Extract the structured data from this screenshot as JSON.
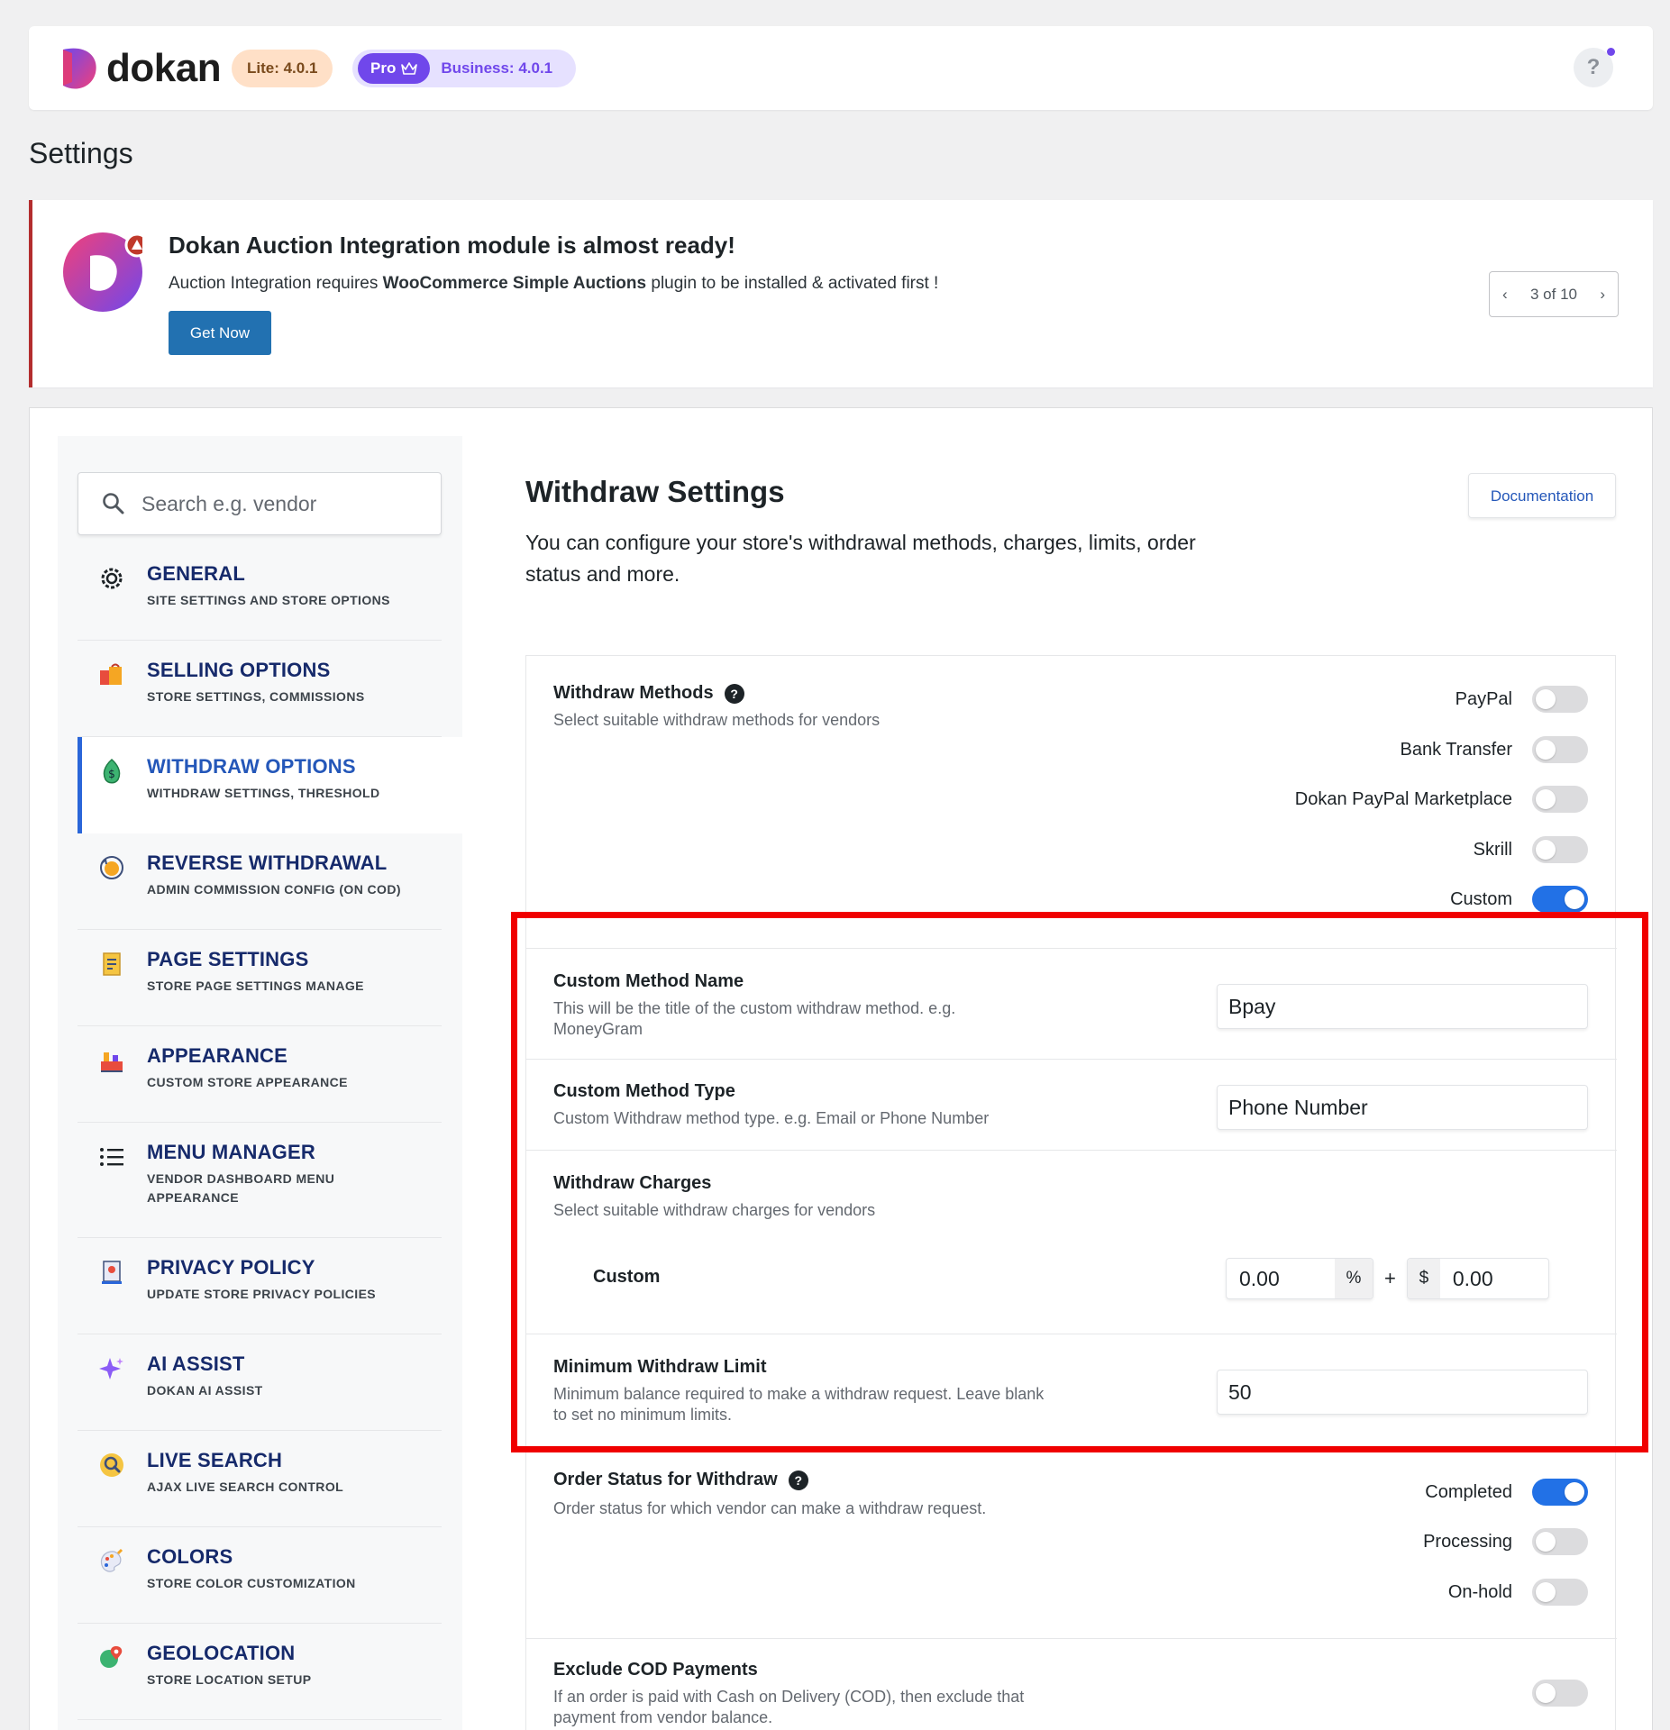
{
  "header": {
    "brand": "dokan",
    "lite_badge": "Lite: 4.0.1",
    "pro_label": "Pro",
    "business_badge": "Business: 4.0.1",
    "help_label": "?"
  },
  "page": {
    "title": "Settings"
  },
  "notice": {
    "title": "Dokan Auction Integration module is almost ready!",
    "text_pre": "Auction Integration requires ",
    "text_bold": "WooCommerce Simple Auctions",
    "text_post": " plugin to be installed & activated first !",
    "button": "Get Now",
    "pager": "3 of 10"
  },
  "sidebar": {
    "search_placeholder": "Search e.g. vendor",
    "items": [
      {
        "title": "GENERAL",
        "sub": "SITE SETTINGS AND STORE OPTIONS"
      },
      {
        "title": "SELLING OPTIONS",
        "sub": "STORE SETTINGS, COMMISSIONS"
      },
      {
        "title": "WITHDRAW OPTIONS",
        "sub": "WITHDRAW SETTINGS, THRESHOLD"
      },
      {
        "title": "REVERSE WITHDRAWAL",
        "sub": "ADMIN COMMISSION CONFIG (ON COD)"
      },
      {
        "title": "PAGE SETTINGS",
        "sub": "STORE PAGE SETTINGS MANAGE"
      },
      {
        "title": "APPEARANCE",
        "sub": "CUSTOM STORE APPEARANCE"
      },
      {
        "title": "MENU MANAGER",
        "sub": "VENDOR DASHBOARD MENU APPEARANCE"
      },
      {
        "title": "PRIVACY POLICY",
        "sub": "UPDATE STORE PRIVACY POLICIES"
      },
      {
        "title": "AI ASSIST",
        "sub": "DOKAN AI ASSIST"
      },
      {
        "title": "LIVE SEARCH",
        "sub": "AJAX LIVE SEARCH CONTROL"
      },
      {
        "title": "COLORS",
        "sub": "STORE COLOR CUSTOMIZATION"
      },
      {
        "title": "GEOLOCATION",
        "sub": "STORE LOCATION SETUP"
      }
    ]
  },
  "content": {
    "title": "Withdraw Settings",
    "desc": "You can configure your store's withdrawal methods, charges, limits, order status and more.",
    "doc_button": "Documentation",
    "withdraw_methods": {
      "title": "Withdraw Methods",
      "desc": "Select suitable withdraw methods for vendors",
      "options": [
        {
          "label": "PayPal",
          "on": false
        },
        {
          "label": "Bank Transfer",
          "on": false
        },
        {
          "label": "Dokan PayPal Marketplace",
          "on": false
        },
        {
          "label": "Skrill",
          "on": false
        },
        {
          "label": "Custom",
          "on": true
        }
      ]
    },
    "custom_method_name": {
      "title": "Custom Method Name",
      "desc": "This will be the title of the custom withdraw method. e.g. MoneyGram",
      "value": "Bpay"
    },
    "custom_method_type": {
      "title": "Custom Method Type",
      "desc": "Custom Withdraw method type. e.g. Email or Phone Number",
      "value": "Phone Number"
    },
    "withdraw_charges": {
      "title": "Withdraw Charges",
      "desc": "Select suitable withdraw charges for vendors",
      "row_label": "Custom",
      "percent_value": "0.00",
      "percent_unit": "%",
      "plus": "+",
      "fixed_unit": "$",
      "fixed_value": "0.00"
    },
    "min_limit": {
      "title": "Minimum Withdraw Limit",
      "desc": "Minimum balance required to make a withdraw request. Leave blank to set no minimum limits.",
      "value": "50"
    },
    "order_status": {
      "title": "Order Status for Withdraw",
      "desc": "Order status for which vendor can make a withdraw request.",
      "options": [
        {
          "label": "Completed",
          "on": true
        },
        {
          "label": "Processing",
          "on": false
        },
        {
          "label": "On-hold",
          "on": false
        }
      ]
    },
    "exclude_cod": {
      "title": "Exclude COD Payments",
      "desc": "If an order is paid with Cash on Delivery (COD), then exclude that payment from vendor balance.",
      "on": false
    }
  },
  "colors": {
    "accent": "#2271e6",
    "highlight": "#f00000",
    "pro": "#7047eb"
  }
}
